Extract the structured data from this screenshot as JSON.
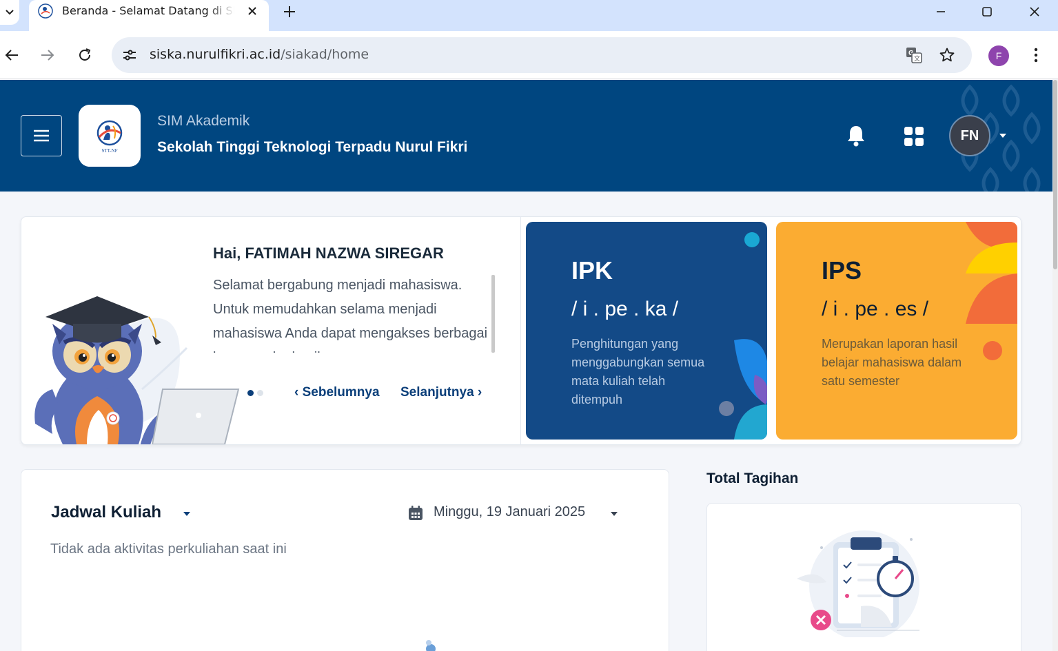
{
  "browser": {
    "tab_title": "Beranda - Selamat Datang di Sistem Informasi Akademik",
    "url_host": "siska.nurulfikri.ac.id",
    "url_path": "/siakad/home",
    "profile_initial": "F"
  },
  "header": {
    "subtitle": "SIM Akademik",
    "title": "Sekolah Tinggi Teknologi Terpadu Nurul Fikri",
    "user_initials": "FN",
    "logo_text": "STT-NF"
  },
  "welcome": {
    "greeting": "Hai, FATIMAH NAZWA SIREGAR",
    "text": "Selamat bergabung menjadi mahasiswa. Untuk memudahkan selama menjadi mahasiswa Anda dapat mengakses berbagai layanan akademik",
    "prev_label": "Sebelumnya",
    "next_label": "Selanjutnya",
    "slides": 2,
    "active_slide": 1
  },
  "ipk": {
    "title": "IPK",
    "phonetic": "/ i . pe . ka /",
    "description": "Penghitungan yang menggabungkan semua mata kuliah telah ditempuh",
    "color": "#134a87"
  },
  "ips": {
    "title": "IPS",
    "phonetic": "/ i . pe . es /",
    "description": "Merupakan laporan hasil belajar mahasiswa dalam satu semester",
    "color": "#fbac32"
  },
  "schedule": {
    "title": "Jadwal Kuliah",
    "date": "Minggu, 19 Januari 2025",
    "empty_text": "Tidak ada aktivitas perkuliahan saat ini"
  },
  "bill": {
    "heading": "Total Tagihan"
  },
  "colors": {
    "header_bg": "#004680",
    "primary": "#0b3f7a",
    "accent_orange": "#fbac32"
  }
}
